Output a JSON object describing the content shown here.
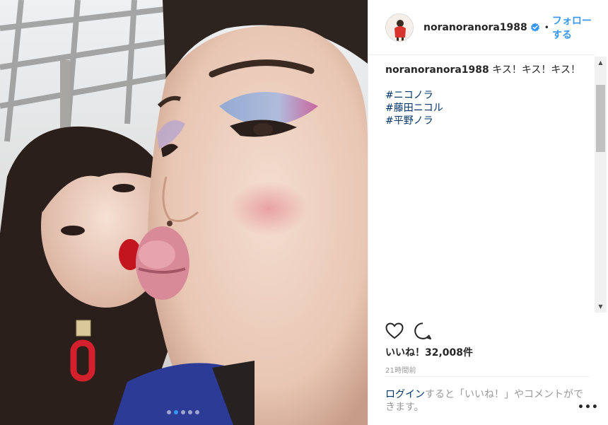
{
  "post": {
    "username": "noranoranora1988",
    "follow_label": "フォローする",
    "separator": "•",
    "caption_text": "キス！キス！キス！",
    "hashtags": [
      "#ニコノラ",
      "#藤田ニコル",
      "#平野ノラ"
    ],
    "likes_label": "いいね！32,008件",
    "timestamp": "21時間前",
    "carousel": {
      "count": 5,
      "active_index": 1
    }
  },
  "footer": {
    "login_label": "ログイン",
    "prompt_text": "すると「いいね！」やコメントができます。",
    "more_label": "•••"
  },
  "colors": {
    "link_blue": "#3897f0",
    "hashtag_blue": "#003569",
    "muted_gray": "#999999",
    "text": "#262626"
  },
  "icons": {
    "verified": "verified-badge-icon",
    "like": "heart-outline-icon",
    "comment": "comment-bubble-icon",
    "more": "more-dots-icon"
  }
}
